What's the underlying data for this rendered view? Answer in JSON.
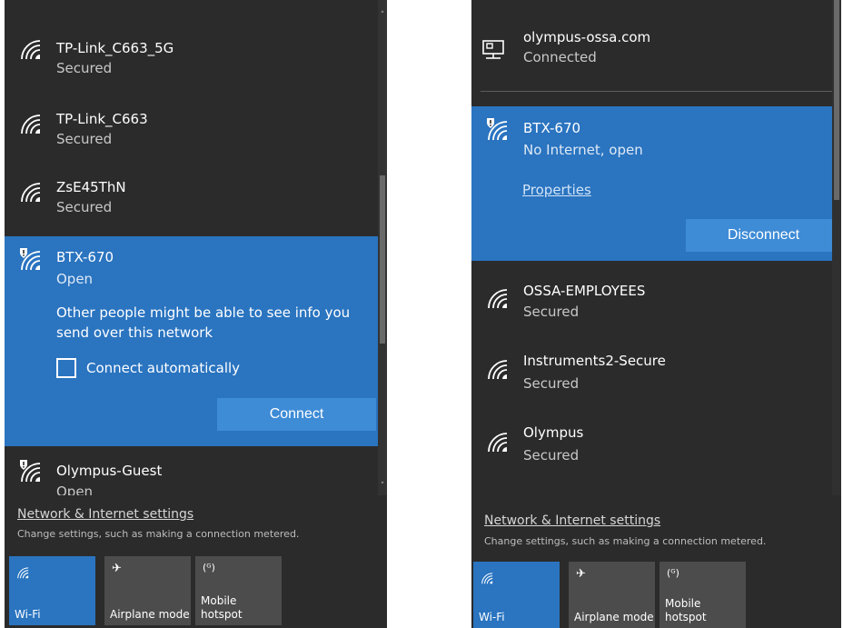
{
  "left": {
    "networks": [
      {
        "name": "TP-Link_C663_5G",
        "status": "Secured",
        "icon": "wifi-icon"
      },
      {
        "name": "TP-Link_C663",
        "status": "Secured",
        "icon": "wifi-icon"
      },
      {
        "name": "ZsE45ThN",
        "status": "Secured",
        "icon": "wifi-icon"
      },
      {
        "name": "BTX-670",
        "status": "Open",
        "icon": "wifi-unsecured-icon"
      },
      {
        "name": "Olympus-Guest",
        "status": "Open",
        "icon": "wifi-unsecured-icon"
      }
    ],
    "warning": "Other people might be able to see info you send over this network",
    "connect_auto_label": "Connect automatically",
    "connect_button": "Connect",
    "settings_link": "Network & Internet settings",
    "settings_desc": "Change settings, such as making a connection metered.",
    "quick_actions": [
      {
        "label": "Wi-Fi",
        "icon": "wifi-icon",
        "active": true
      },
      {
        "label": "Airplane mode",
        "icon": "airplane-icon",
        "active": false
      },
      {
        "label": "Mobile hotspot",
        "icon": "hotspot-icon",
        "active": false
      }
    ]
  },
  "right": {
    "wired": {
      "name": "olympus-ossa.com",
      "status": "Connected",
      "icon": "ethernet-icon"
    },
    "networks": [
      {
        "name": "BTX-670",
        "status": "No Internet, open",
        "icon": "wifi-unsecured-icon"
      },
      {
        "name": "OSSA-EMPLOYEES",
        "status": "Secured",
        "icon": "wifi-icon"
      },
      {
        "name": "Instruments2-Secure",
        "status": "Secured",
        "icon": "wifi-icon"
      },
      {
        "name": "Olympus",
        "status": "Secured",
        "icon": "wifi-icon"
      }
    ],
    "properties_link": "Properties",
    "disconnect_button": "Disconnect",
    "settings_link": "Network & Internet settings",
    "settings_desc": "Change settings, such as making a connection metered.",
    "quick_actions": [
      {
        "label": "Wi-Fi",
        "icon": "wifi-icon",
        "active": true
      },
      {
        "label": "Airplane mode",
        "icon": "airplane-icon",
        "active": false
      },
      {
        "label": "Mobile hotspot",
        "icon": "hotspot-icon",
        "active": false
      }
    ]
  },
  "colors": {
    "panel_bg": "#2b2b2b",
    "accent": "#2a74c0",
    "button": "#3e8bd6",
    "tile": "#4c4c4c"
  }
}
